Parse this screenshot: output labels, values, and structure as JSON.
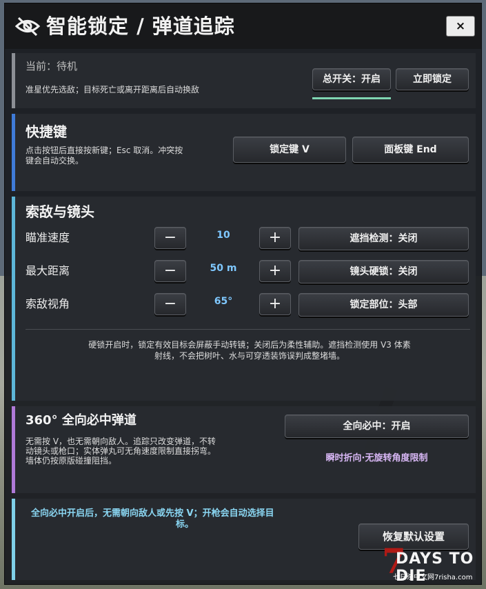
{
  "title_bar": {
    "title": "智能锁定 / 弹道追踪",
    "close_label": "×"
  },
  "status": {
    "current": "当前：待机",
    "hint": "准星优先选敌；目标死亡或离开距离后自动换敌",
    "master_switch_label": "总开关：开启",
    "lock_now_label": "立即锁定",
    "accent_color": "#7fd6b2"
  },
  "hotkeys": {
    "heading": "快捷键",
    "hint_line1": "点击按钮后直接按新键；Esc 取消。冲突按",
    "hint_line2": "键会自动交换。",
    "lock_key_label": "锁定键 V",
    "panel_key_label": "面板键 End",
    "bar_color": "#3f7bd8"
  },
  "targeting": {
    "heading": "索敌与镜头",
    "rows": [
      {
        "label": "瞄准速度",
        "minus": "−",
        "value": "10",
        "plus": "+",
        "toggle": "遮挡检测：关闭"
      },
      {
        "label": "最大距离",
        "minus": "−",
        "value": "50 m",
        "plus": "+",
        "toggle": "镜头硬锁：关闭"
      },
      {
        "label": "索敌视角",
        "minus": "−",
        "value": "65°",
        "plus": "+",
        "toggle": "锁定部位：头部"
      }
    ],
    "note_line1": "硬锁开启时，锁定有效目标会屏蔽手动转镜；关闭后为柔性辅助。遮挡检测使用 V3 体素",
    "note_line2": "射线，不会把树叶、水与可穿透装饰误判成整堵墙。",
    "bar_color": "#5db6d8"
  },
  "omni": {
    "heading": "360° 全向必中弹道",
    "desc_line1": "无需按 V，也无需朝向敌人。追踪只改变弹道，不转",
    "desc_line2": "动镜头或枪口；实体弹丸可无角速度限制直接拐弯。",
    "desc_line3": "墙体仍按原版碰撞阻挡。",
    "toggle_label": "全向必中：开启",
    "subnote": "瞬时折向·无旋转角度限制",
    "bar_color": "#b07ad8"
  },
  "footer": {
    "note_line1": "全向必中开启后，无需朝向敌人或先按 V；开枪会自动选择目",
    "note_line2": "标。",
    "reset_label": "恢复默认设置",
    "bar_color": "#7fd0e8"
  },
  "logo": {
    "seven": "7",
    "days": "DAYS TO DIE",
    "site": "七日杀中文网7risha.com"
  },
  "icons": {
    "title_icon": "eye-slash-icon"
  }
}
